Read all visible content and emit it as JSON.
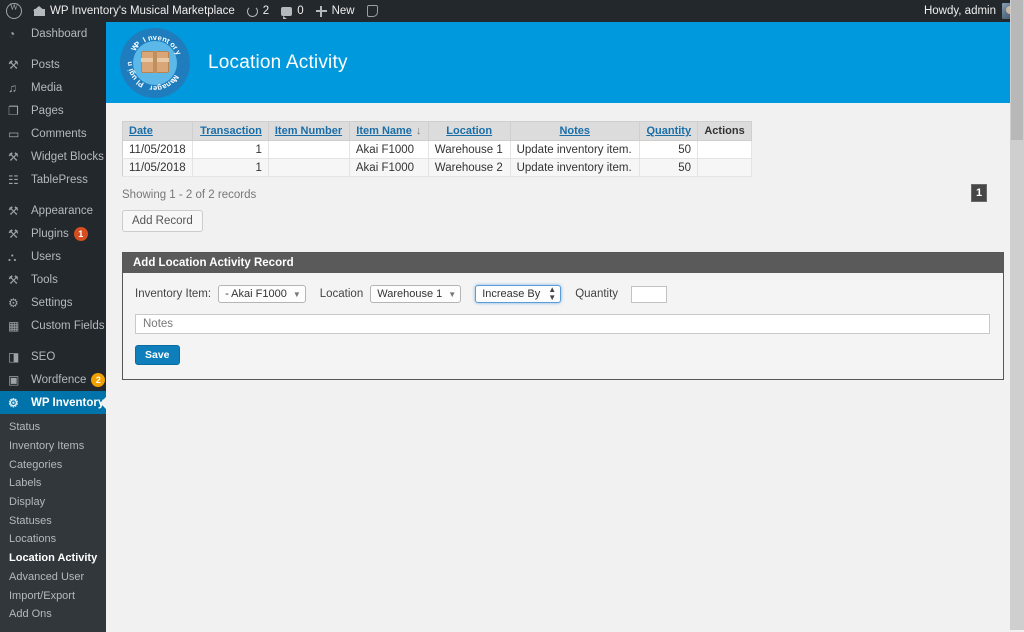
{
  "adminbar": {
    "site_title": "WP Inventory's Musical Marketplace",
    "updates_count": "2",
    "comments_count": "0",
    "new_label": "New",
    "howdy": "Howdy, admin"
  },
  "sidebar": {
    "items": [
      {
        "label": "Dashboard",
        "icon": "dashboard-icon"
      },
      {
        "label": "Posts",
        "icon": "pin-icon"
      },
      {
        "label": "Media",
        "icon": "media-icon"
      },
      {
        "label": "Pages",
        "icon": "pages-icon"
      },
      {
        "label": "Comments",
        "icon": "comment-icon"
      },
      {
        "label": "Widget Blocks",
        "icon": "pin-icon"
      },
      {
        "label": "TablePress",
        "icon": "table-icon"
      },
      {
        "label": "Appearance",
        "icon": "brush-icon"
      },
      {
        "label": "Plugins",
        "icon": "plug-icon",
        "badge": "1"
      },
      {
        "label": "Users",
        "icon": "user-icon"
      },
      {
        "label": "Tools",
        "icon": "wrench-icon"
      },
      {
        "label": "Settings",
        "icon": "settings-icon"
      },
      {
        "label": "Custom Fields",
        "icon": "fields-icon"
      },
      {
        "label": "SEO",
        "icon": "yoast-icon"
      },
      {
        "label": "Wordfence",
        "icon": "wordfence-icon",
        "badge": "2"
      },
      {
        "label": "WP Inventory",
        "icon": "inventory-icon",
        "active": true
      }
    ],
    "submenu": [
      {
        "label": "Status"
      },
      {
        "label": "Inventory Items"
      },
      {
        "label": "Categories"
      },
      {
        "label": "Labels"
      },
      {
        "label": "Display"
      },
      {
        "label": "Statuses"
      },
      {
        "label": "Locations"
      },
      {
        "label": "Location Activity",
        "current": true
      },
      {
        "label": "Advanced User"
      },
      {
        "label": "Import/Export"
      },
      {
        "label": "Add Ons"
      }
    ]
  },
  "banner": {
    "title": "Location Activity",
    "logo_words": [
      "WP Inventory",
      "Manager Plugin"
    ],
    "bg_color": "#0099dd"
  },
  "table": {
    "columns": [
      {
        "label": "Date",
        "sortable": true,
        "align": "left"
      },
      {
        "label": "Transaction",
        "sortable": true,
        "align": "right"
      },
      {
        "label": "Item Number",
        "sortable": true,
        "align": "left"
      },
      {
        "label": "Item Name",
        "sortable": true,
        "align": "center",
        "sort_arrow": "↓"
      },
      {
        "label": "Location",
        "sortable": true,
        "align": "center"
      },
      {
        "label": "Notes",
        "sortable": true,
        "align": "center"
      },
      {
        "label": "Quantity",
        "sortable": true,
        "align": "right"
      },
      {
        "label": "Actions",
        "sortable": false,
        "align": "center"
      }
    ],
    "rows": [
      {
        "date": "11/05/2018",
        "transaction": "1",
        "item_number": "",
        "item_name": "Akai F1000",
        "location": "Warehouse 1",
        "notes": "Update inventory item.",
        "quantity": "50",
        "actions": ""
      },
      {
        "date": "11/05/2018",
        "transaction": "1",
        "item_number": "",
        "item_name": "Akai F1000",
        "location": "Warehouse 2",
        "notes": "Update inventory item.",
        "quantity": "50",
        "actions": ""
      }
    ],
    "showing": "Showing 1 - 2 of 2 records",
    "add_record_label": "Add Record",
    "page_badge": "1"
  },
  "form": {
    "heading": "Add Location Activity Record",
    "inventory_item_label": "Inventory Item:",
    "inventory_item_value": "- Akai F1000",
    "location_label": "Location",
    "location_value": "Warehouse 1",
    "direction_value": "Increase By",
    "quantity_label": "Quantity",
    "quantity_value": "",
    "notes_placeholder": "Notes",
    "save_label": "Save"
  }
}
